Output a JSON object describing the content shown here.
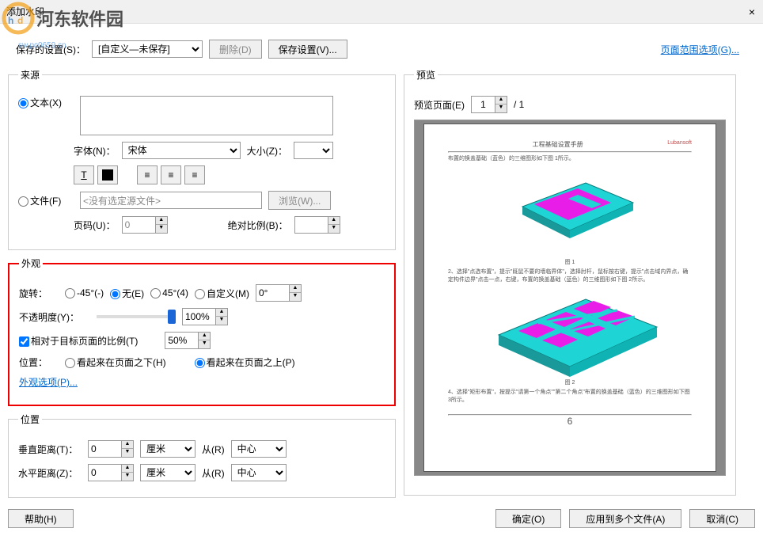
{
  "window": {
    "title": "添加水印",
    "close": "×"
  },
  "logo": {
    "text": "河东软件园",
    "sub": "sw.pc0659.cn"
  },
  "top": {
    "saved_settings_label": "保存的设置(S)：",
    "saved_settings_value": "[自定义—未保存]",
    "delete_btn": "删除(D)",
    "save_btn": "保存设置(V)...",
    "page_range_link": "页面范围选项(G)..."
  },
  "source": {
    "legend": "来源",
    "text_radio": "文本(X)",
    "font_label": "字体(N)：",
    "font_value": "宋体",
    "size_label": "大小(Z)：",
    "size_value": "",
    "file_radio": "文件(F)",
    "file_placeholder": "<没有选定源文件>",
    "browse_btn": "浏览(W)...",
    "page_label": "页码(U)：",
    "page_value": "0",
    "scale_label": "绝对比例(B)："
  },
  "appearance": {
    "legend": "外观",
    "rotate_label": "旋转：",
    "rot_neg45": "-45°(-)",
    "rot_none": "无(E)",
    "rot_45": "45°(4)",
    "rot_custom": "自定义(M)",
    "rot_value": "0°",
    "opacity_label": "不透明度(Y)：",
    "opacity_value": "100%",
    "relative_scale_cb": "相对于目标页面的比例(T)",
    "relative_scale_value": "50%",
    "position_label": "位置：",
    "behind": "看起来在页面之下(H)",
    "front": "看起来在页面之上(P)",
    "options_link": "外观选项(P)..."
  },
  "position": {
    "legend": "位置",
    "vdist_label": "垂直距离(T)：",
    "vdist_value": "0",
    "hdist_label": "水平距离(Z)：",
    "hdist_value": "0",
    "unit": "厘米",
    "from_label": "从(R)",
    "from_value": "中心"
  },
  "preview": {
    "legend": "预览",
    "page_label": "预览页面(E)",
    "page_value": "1",
    "page_total": "/ 1",
    "doc_title": "工程基础设置手册",
    "doc_brand": "Lubansoft",
    "text1": "布置的换盖基础（蓝色）的三维图形如下图 1所示。",
    "cap1": "图 1",
    "text2": "2、选择\"点选布置\"，提示\"既鼠不要的墙临界体\"，选择肘杆，鼠标按右键，提示\"点击域内界点，确定构件边界\"点击一点，右键，布置的换盖基础（蓝色）的三维图形如下图 2所示。",
    "cap2": "图 2",
    "text3": "4、选择\"矩形布置\"，按提示\"请第一个角点\"\"第二个角点\"布置的换盖基础（蓝色）的三维图形如下图 3所示。",
    "page_num": "6"
  },
  "bottom": {
    "help": "帮助(H)",
    "ok": "确定(O)",
    "apply_multi": "应用到多个文件(A)",
    "cancel": "取消(C)"
  }
}
